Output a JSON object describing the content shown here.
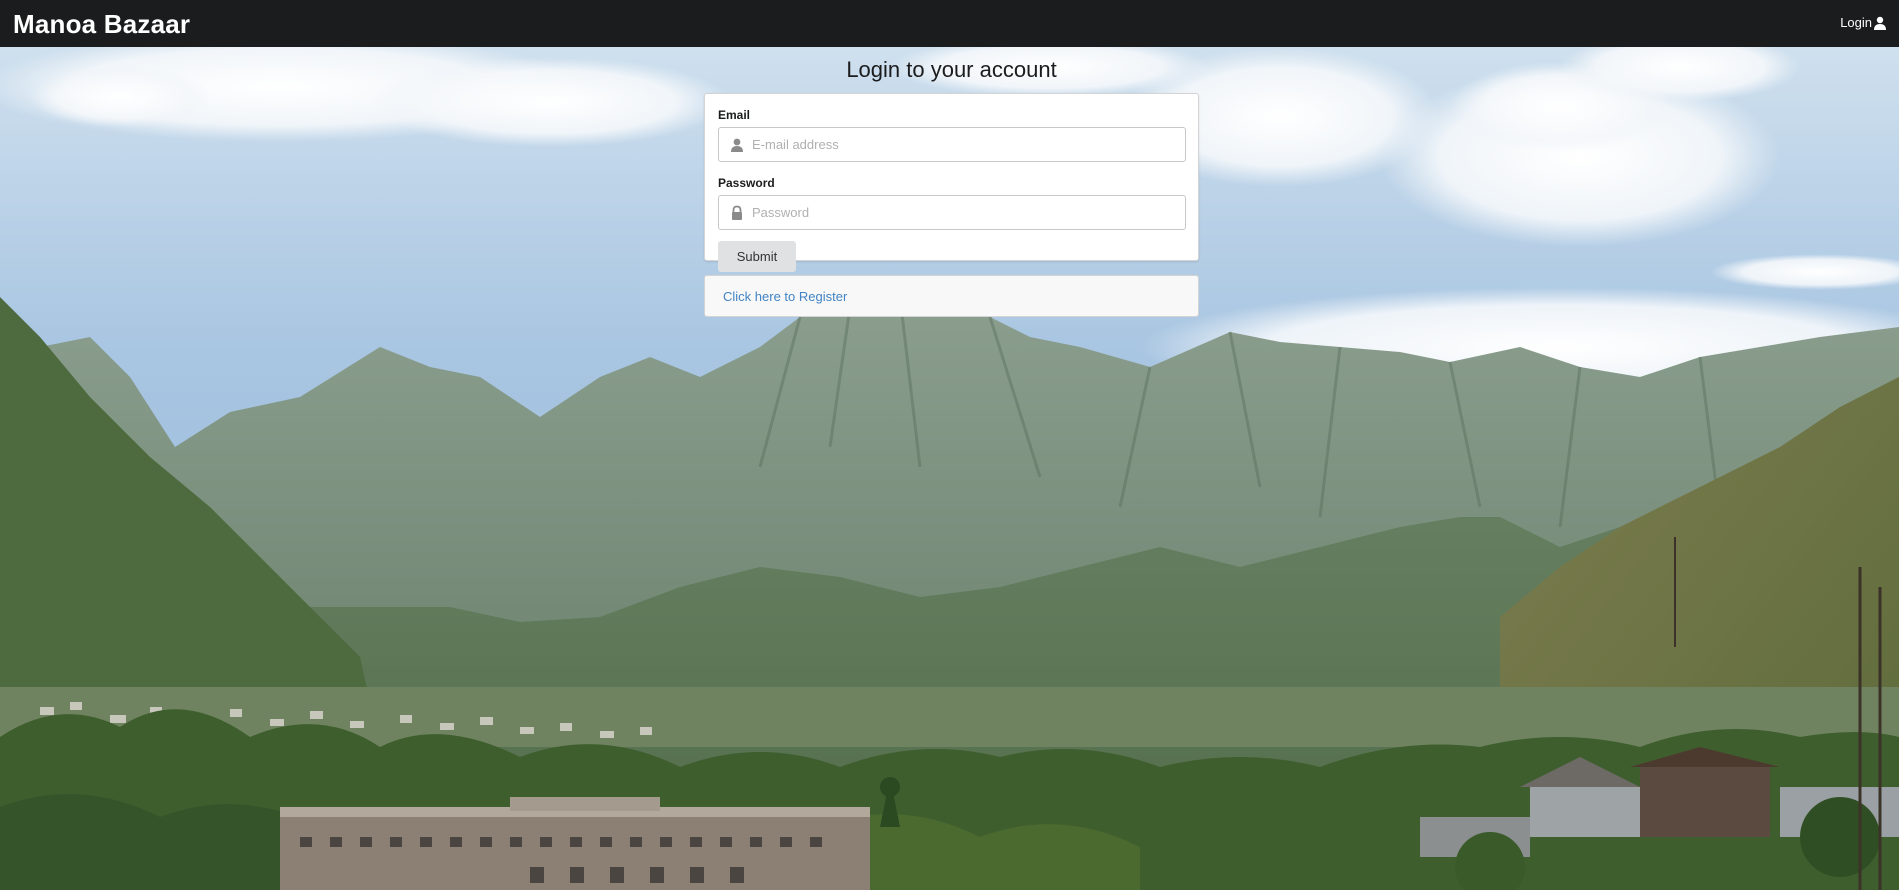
{
  "navbar": {
    "brand": "Manoa Bazaar",
    "login_label": "Login",
    "login_icon": "user-icon"
  },
  "main": {
    "title": "Login to your account",
    "email": {
      "label": "Email",
      "placeholder": "E-mail address",
      "value": "",
      "icon": "user-icon"
    },
    "password": {
      "label": "Password",
      "placeholder": "Password",
      "value": "",
      "icon": "lock-icon"
    },
    "submit_label": "Submit",
    "register_link": "Click here to Register"
  },
  "colors": {
    "navbar_bg": "#1b1c1d",
    "link": "#4183c4",
    "button_bg": "#e0e1e2"
  }
}
